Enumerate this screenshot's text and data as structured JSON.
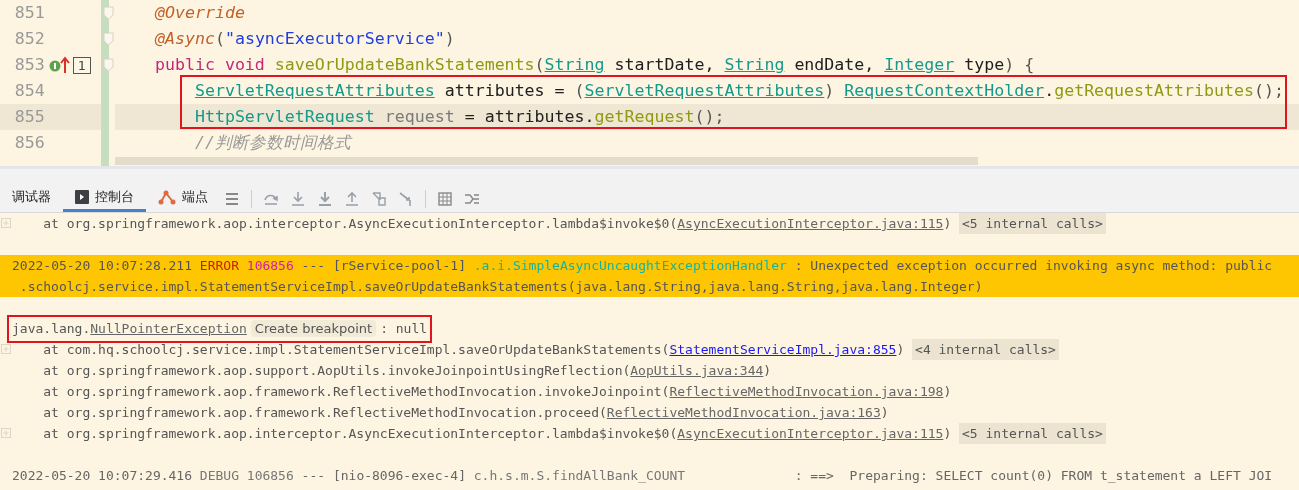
{
  "editor": {
    "lines": [
      {
        "number": "851",
        "kind": "member",
        "fold": true,
        "current": false,
        "boxed": false,
        "tokens": [
          {
            "kind": "annotation",
            "text": "@Override"
          }
        ]
      },
      {
        "number": "852",
        "kind": "member",
        "fold": true,
        "current": false,
        "boxed": false,
        "tokens": [
          {
            "kind": "annotation",
            "text": "@Async"
          },
          {
            "kind": "punct",
            "text": "("
          },
          {
            "kind": "string",
            "text": "\"asyncExecutorService\""
          },
          {
            "kind": "punct",
            "text": ")"
          }
        ]
      },
      {
        "number": "853",
        "kind": "member",
        "fold": true,
        "current": false,
        "boxed": false,
        "override_marker": true,
        "badge": "1",
        "tokens": [
          {
            "kind": "keyword",
            "text": "public void "
          },
          {
            "kind": "method",
            "text": "saveOrUpdateBankStatements"
          },
          {
            "kind": "punct",
            "text": "("
          },
          {
            "kind": "type",
            "text": "String"
          },
          {
            "kind": "plain",
            "text": " startDate, "
          },
          {
            "kind": "type",
            "text": "String"
          },
          {
            "kind": "plain",
            "text": " endDate, "
          },
          {
            "kind": "type",
            "text": "Integer"
          },
          {
            "kind": "plain",
            "text": " type"
          },
          {
            "kind": "punct",
            "text": ") {"
          }
        ]
      },
      {
        "number": "854",
        "kind": "body",
        "fold": false,
        "current": false,
        "boxed": true,
        "tokens": [
          {
            "kind": "type",
            "text": "ServletRequestAttributes"
          },
          {
            "kind": "plain",
            "text": " attributes = "
          },
          {
            "kind": "punct",
            "text": "("
          },
          {
            "kind": "type",
            "text": "ServletRequestAttributes"
          },
          {
            "kind": "punct",
            "text": ") "
          },
          {
            "kind": "type",
            "text": "RequestContextHolder"
          },
          {
            "kind": "plain",
            "text": "."
          },
          {
            "kind": "method",
            "text": "getRequestAttributes"
          },
          {
            "kind": "punct",
            "text": "();"
          }
        ]
      },
      {
        "number": "855",
        "kind": "body",
        "fold": false,
        "current": true,
        "boxed": true,
        "tokens": [
          {
            "kind": "class",
            "text": "HttpServletRequest"
          },
          {
            "kind": "unused",
            "text": " request"
          },
          {
            "kind": "plain",
            "text": " = attributes."
          },
          {
            "kind": "method",
            "text": "getRequest"
          },
          {
            "kind": "punct",
            "text": "();"
          }
        ]
      },
      {
        "number": "856",
        "kind": "body",
        "fold": false,
        "current": false,
        "boxed": false,
        "tokens": [
          {
            "kind": "comment",
            "text": "//判断参数时间格式"
          }
        ]
      }
    ]
  },
  "toolbar": {
    "tabs": [
      {
        "label": "调试器",
        "selected": false
      },
      {
        "label": "控制台",
        "selected": true
      },
      {
        "label": "端点",
        "selected": false
      }
    ]
  },
  "console": {
    "rows": [
      {
        "kind": "frame",
        "foldable": true,
        "text": "at org.springframework.aop.interceptor.AsyncExecutionInterceptor.lambda$invoke$0(",
        "link": "AsyncExecutionInterceptor.java:115",
        "highlighted": false,
        "suffix": ")",
        "internal": "<5 internal calls>"
      },
      {
        "kind": "blank"
      },
      {
        "kind": "error_log",
        "time": "2022-05-20 10:07:28.211",
        "level": "ERROR",
        "pid": "106856",
        "sep": "---",
        "thread": "[rService-pool-1]",
        "logger": ".a.i.SimpleAsyncUncaughtExceptionHandler",
        "message": ": Unexpected exception occurred invoking async method: public",
        "continuation": ".schoolcj.service.impl.StatementServiceImpl.saveOrUpdateBankStatements(java.lang.String,java.lang.String,java.lang.Integer)"
      },
      {
        "kind": "blank"
      },
      {
        "kind": "exception",
        "boxed": true,
        "text": "java.lang.",
        "link": "NullPointerException",
        "button": "Create breakpoint",
        "message": ": null"
      },
      {
        "kind": "frame",
        "foldable": true,
        "text": "at com.hq.schoolcj.service.impl.StatementServiceImpl.saveOrUpdateBankStatements(",
        "link": "StatementServiceImpl.java:855",
        "highlighted": true,
        "suffix": ")",
        "internal": "<4 internal calls>"
      },
      {
        "kind": "frame",
        "foldable": false,
        "text": "at org.springframework.aop.support.AopUtils.invokeJoinpointUsingReflection(",
        "link": "AopUtils.java:344",
        "highlighted": false,
        "suffix": ")"
      },
      {
        "kind": "frame",
        "foldable": false,
        "text": "at org.springframework.aop.framework.ReflectiveMethodInvocation.invokeJoinpoint(",
        "link": "ReflectiveMethodInvocation.java:198",
        "highlighted": false,
        "suffix": ")"
      },
      {
        "kind": "frame",
        "foldable": false,
        "text": "at org.springframework.aop.framework.ReflectiveMethodInvocation.proceed(",
        "link": "ReflectiveMethodInvocation.java:163",
        "highlighted": false,
        "suffix": ")"
      },
      {
        "kind": "frame",
        "foldable": true,
        "text": "at org.springframework.aop.interceptor.AsyncExecutionInterceptor.lambda$invoke$0(",
        "link": "AsyncExecutionInterceptor.java:115",
        "highlighted": false,
        "suffix": ")",
        "internal": "<5 internal calls>"
      },
      {
        "kind": "blank"
      },
      {
        "kind": "log",
        "time": "2022-05-20 10:07:29.416",
        "level": "DEBUG",
        "pid": "106856",
        "sep": "---",
        "thread": "[nio-8096-exec-4]",
        "logger": "c.h.s.m.S.findAllBank_COUNT",
        "message": ": ==>  Preparing: SELECT count(0) FROM t_statement a LEFT JOI"
      }
    ]
  }
}
